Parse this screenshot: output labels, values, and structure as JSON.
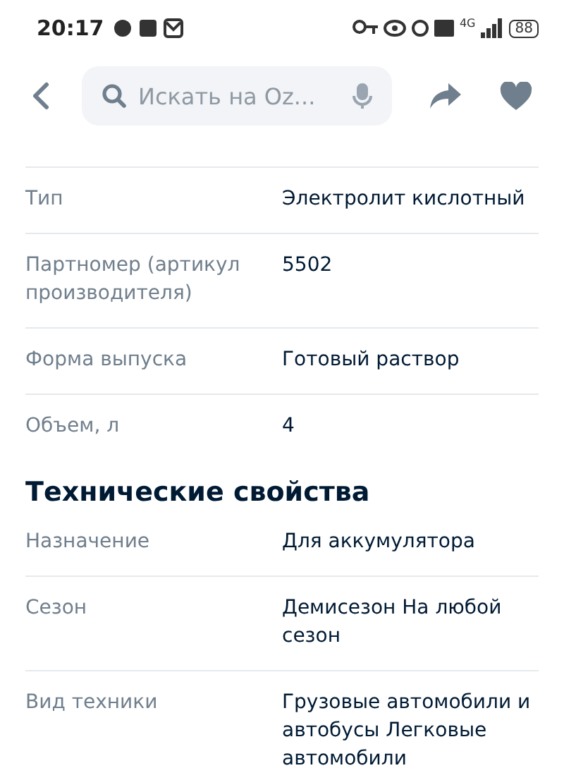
{
  "status_bar": {
    "time": "20:17",
    "network": "4G",
    "battery": "88"
  },
  "search": {
    "placeholder": "Искать на Oz..."
  },
  "sections": [
    {
      "rows": [
        {
          "label": "Тип",
          "value": "Электролит кислотный"
        },
        {
          "label": "Партномер (артикул производителя)",
          "value": "5502"
        },
        {
          "label": "Форма выпуска",
          "value": "Готовый раствор"
        },
        {
          "label": "Объем, л",
          "value": "4"
        }
      ]
    },
    {
      "title": "Технические свойства",
      "rows": [
        {
          "label": "Назначение",
          "value": "Для аккумулятора"
        },
        {
          "label": "Сезон",
          "value": "Демисезон На любой сезон"
        },
        {
          "label": "Вид техники",
          "value": "Грузовые автомобили и автобусы Легковые автомобили"
        }
      ]
    }
  ]
}
